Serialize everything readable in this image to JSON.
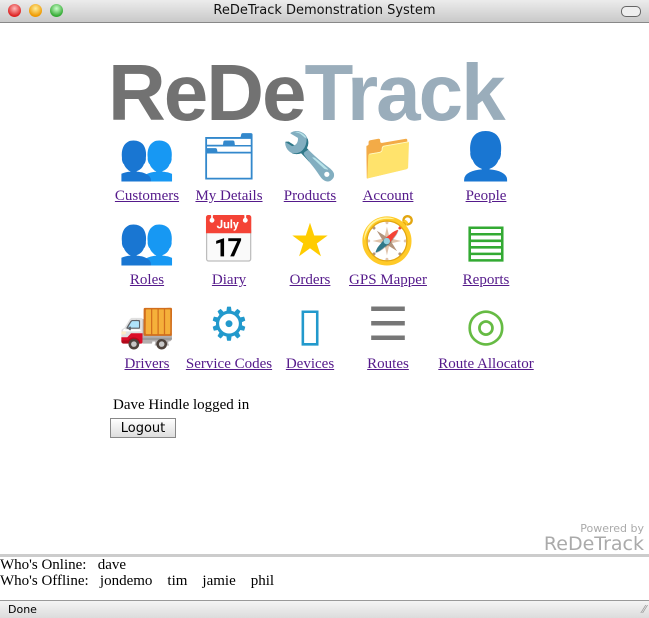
{
  "window": {
    "title": "ReDeTrack Demonstration System"
  },
  "logo": {
    "part1": "ReDe",
    "part2": "Track",
    "color1": "#727272",
    "color2": "#9aadbb"
  },
  "menu": [
    {
      "label": "Customers",
      "icon": "customers-icon",
      "glyph": "👥"
    },
    {
      "label": "My Details",
      "icon": "my-details-icon",
      "glyph": "🗂"
    },
    {
      "label": "Products",
      "icon": "wrench-icon",
      "glyph": "🔧"
    },
    {
      "label": "Account",
      "icon": "account-icon",
      "glyph": "📁"
    },
    {
      "label": "People",
      "icon": "person-icon",
      "glyph": "👤"
    },
    {
      "label": "Roles",
      "icon": "roles-icon",
      "glyph": "👥"
    },
    {
      "label": "Diary",
      "icon": "calendar-icon",
      "glyph": "📅"
    },
    {
      "label": "Orders",
      "icon": "star-icon",
      "glyph": "★"
    },
    {
      "label": "GPS Mapper",
      "icon": "compass-icon",
      "glyph": "🧭"
    },
    {
      "label": "Reports",
      "icon": "reports-icon",
      "glyph": "▤"
    },
    {
      "label": "Drivers",
      "icon": "truck-icon",
      "glyph": "🚚"
    },
    {
      "label": "Service Codes",
      "icon": "gear-icon",
      "glyph": "⚙"
    },
    {
      "label": "Devices",
      "icon": "pda-icon",
      "glyph": "▯"
    },
    {
      "label": "Routes",
      "icon": "routes-list-icon",
      "glyph": "☰"
    },
    {
      "label": "Route Allocator",
      "icon": "route-map-icon",
      "glyph": "◎"
    }
  ],
  "session": {
    "logged_in": "Dave Hindle logged in",
    "logout": "Logout"
  },
  "powered": {
    "line1": "Powered by",
    "line2": "ReDeTrack"
  },
  "online": {
    "label": "Who's Online:",
    "users": "dave"
  },
  "offline": {
    "label": "Who's Offline:",
    "users": "jondemo    tim    jamie    phil"
  },
  "statusbar": {
    "text": "Done"
  }
}
